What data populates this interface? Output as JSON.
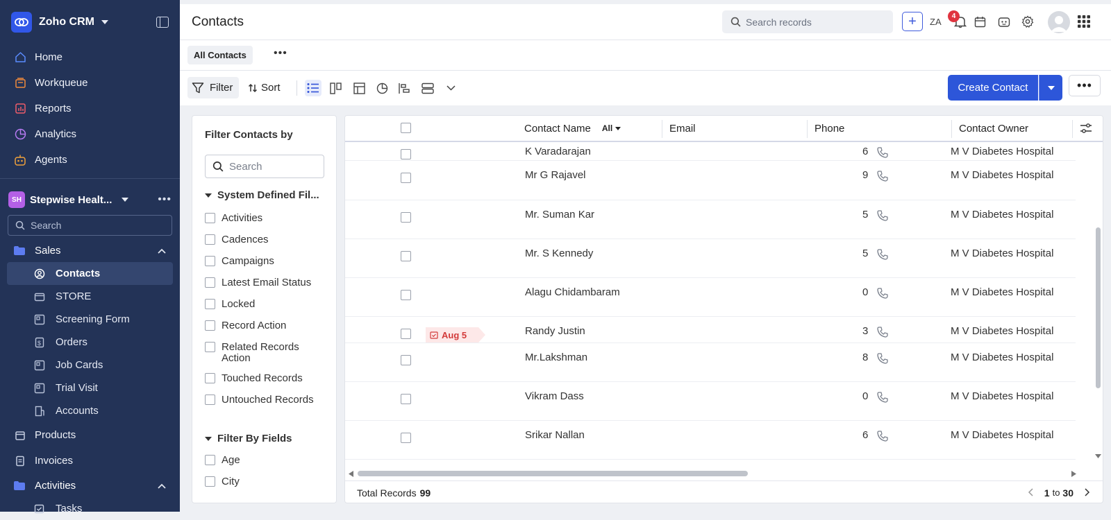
{
  "app": {
    "name": "Zoho CRM"
  },
  "sidebar": {
    "main_items": [
      {
        "label": "Home",
        "icon": "home-icon"
      },
      {
        "label": "Workqueue",
        "icon": "workqueue-icon"
      },
      {
        "label": "Reports",
        "icon": "reports-icon"
      },
      {
        "label": "Analytics",
        "icon": "analytics-icon"
      },
      {
        "label": "Agents",
        "icon": "agents-icon"
      }
    ],
    "workspace": {
      "badge": "SH",
      "name": "Stepwise Healt..."
    },
    "search_placeholder": "Search",
    "sales_group": {
      "label": "Sales"
    },
    "sales_items": [
      {
        "label": "Contacts",
        "icon": "contacts-icon",
        "active": true
      },
      {
        "label": "STORE",
        "icon": "store-icon"
      },
      {
        "label": "Screening Form",
        "icon": "screening-form-icon"
      },
      {
        "label": "Orders",
        "icon": "orders-icon"
      },
      {
        "label": "Job Cards",
        "icon": "job-cards-icon"
      },
      {
        "label": "Trial Visit",
        "icon": "trial-visit-icon"
      },
      {
        "label": "Accounts",
        "icon": "accounts-icon"
      }
    ],
    "products": {
      "label": "Products"
    },
    "invoices": {
      "label": "Invoices"
    },
    "activities_group": {
      "label": "Activities"
    },
    "tasks": {
      "label": "Tasks"
    }
  },
  "header": {
    "title": "Contacts",
    "search_placeholder": "Search records",
    "notification_count": "4"
  },
  "view": {
    "tab": "All Contacts"
  },
  "toolbar": {
    "filter_label": "Filter",
    "sort_label": "Sort",
    "create_label": "Create Contact"
  },
  "filter_panel": {
    "title": "Filter Contacts by",
    "search_placeholder": "Search",
    "system_section": "System Defined Fil...",
    "system_options": [
      "Activities",
      "Cadences",
      "Campaigns",
      "Latest Email Status",
      "Locked",
      "Record Action",
      "Related Records Action",
      "Touched Records",
      "Untouched Records"
    ],
    "fields_section": "Filter By Fields",
    "field_options": [
      "Age",
      "City"
    ]
  },
  "table": {
    "columns": {
      "name": "Contact Name",
      "name_filter": "All",
      "email": "Email",
      "phone": "Phone",
      "owner": "Contact Owner"
    },
    "rows": [
      {
        "name": "K Varadarajan",
        "phone": "6",
        "owner": "M V Diabetes Hospital"
      },
      {
        "name": "Mr G Rajavel",
        "phone": "9",
        "owner": "M V Diabetes Hospital"
      },
      {
        "name": "Mr. Suman Kar",
        "phone": "5",
        "owner": "M V Diabetes Hospital"
      },
      {
        "name": "Mr. S Kennedy",
        "phone": "5",
        "owner": "M V Diabetes Hospital"
      },
      {
        "name": "Alagu Chidambaram",
        "phone": "0",
        "owner": "M V Diabetes Hospital"
      },
      {
        "name": "Randy Justin",
        "phone": "3",
        "owner": "M V Diabetes Hospital",
        "tag": "Aug 5"
      },
      {
        "name": "Mr.Lakshman",
        "phone": "8",
        "owner": "M V Diabetes Hospital"
      },
      {
        "name": "Vikram Dass",
        "phone": "0",
        "owner": "M V Diabetes Hospital"
      },
      {
        "name": "Srikar Nallan",
        "phone": "6",
        "owner": "M V Diabetes Hospital"
      }
    ],
    "total_label": "Total Records",
    "total_value": "99",
    "pager": {
      "from": "1",
      "to_word": "to",
      "to": "30"
    }
  }
}
